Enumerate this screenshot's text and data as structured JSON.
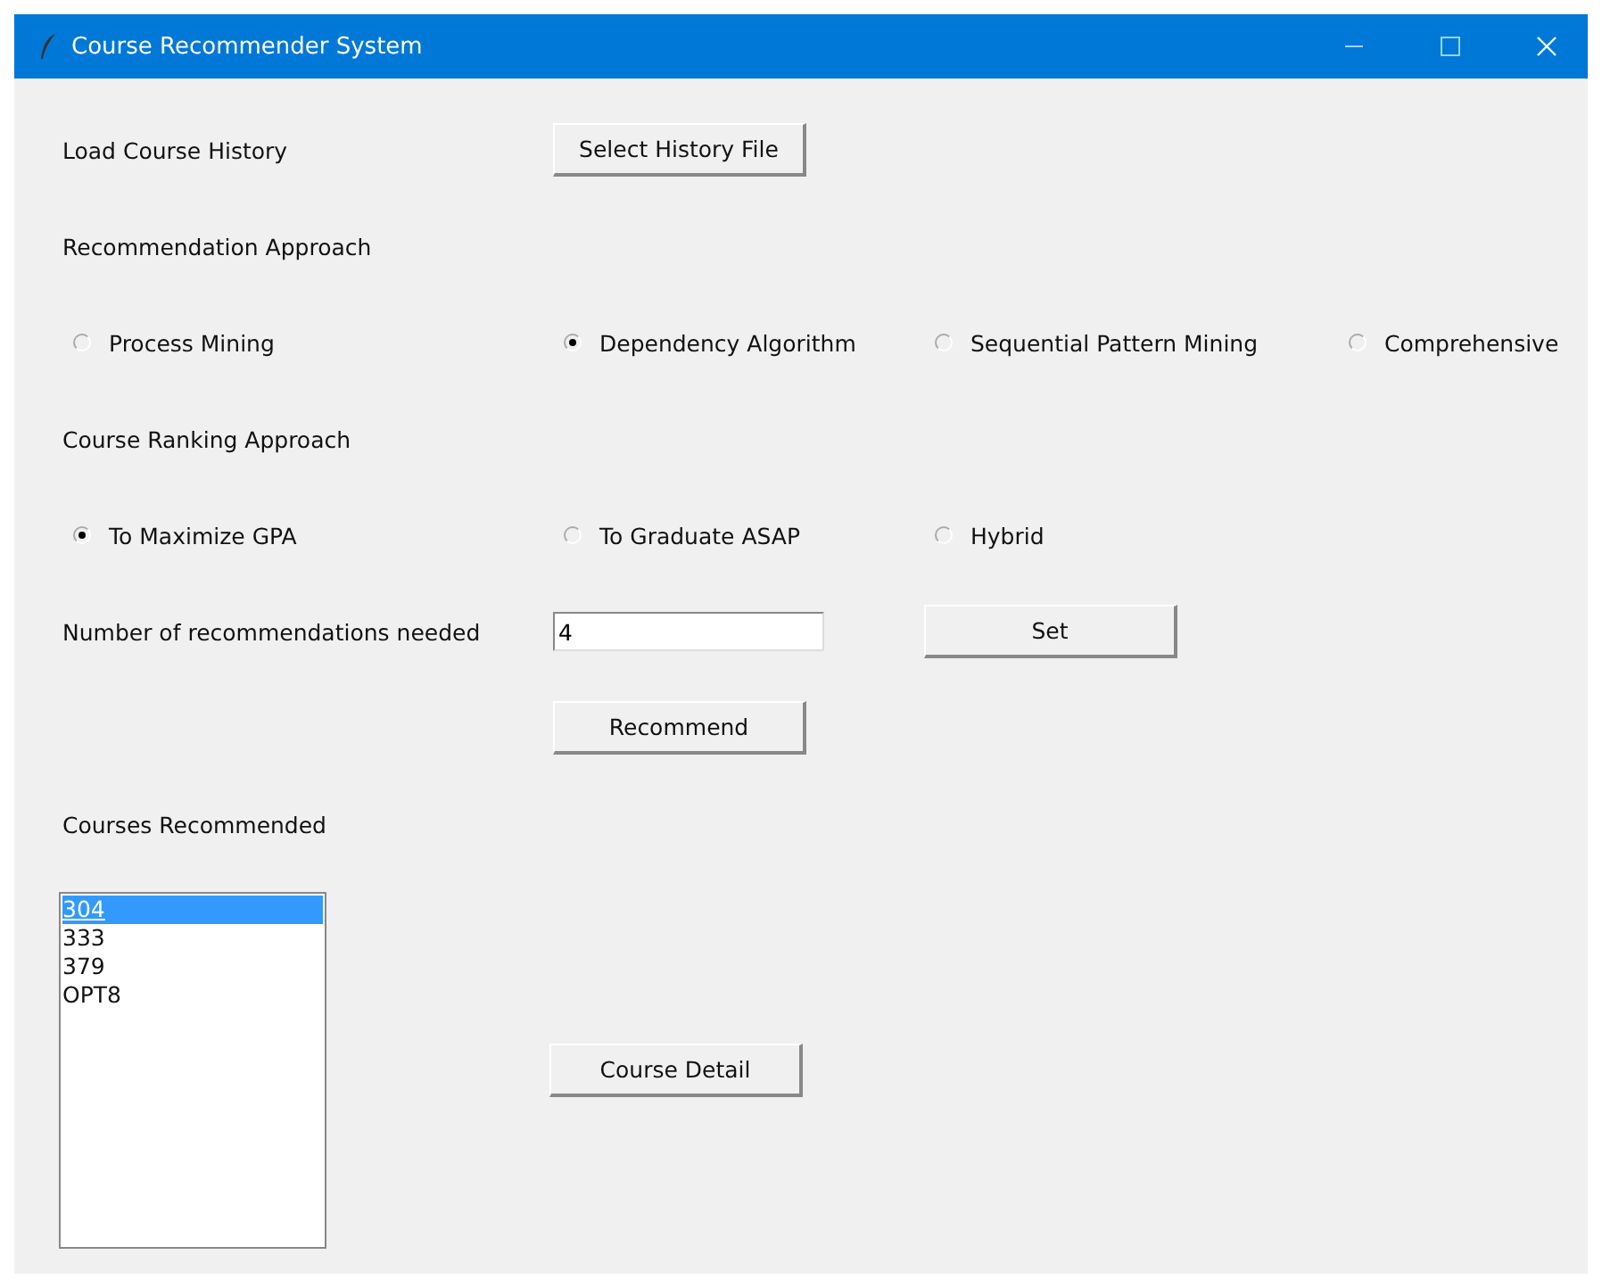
{
  "window": {
    "title": "Course Recommender System"
  },
  "history": {
    "label": "Load Course History",
    "button": "Select History File"
  },
  "recommendation_approach": {
    "label": "Recommendation Approach",
    "options": [
      {
        "label": "Process Mining",
        "selected": false
      },
      {
        "label": "Dependency Algorithm",
        "selected": true
      },
      {
        "label": "Sequential Pattern Mining",
        "selected": false
      },
      {
        "label": "Comprehensive",
        "selected": false
      }
    ]
  },
  "ranking_approach": {
    "label": "Course Ranking Approach",
    "options": [
      {
        "label": "To Maximize GPA",
        "selected": true
      },
      {
        "label": "To Graduate ASAP",
        "selected": false
      },
      {
        "label": "Hybrid",
        "selected": false
      }
    ]
  },
  "count": {
    "label": "Number of recommendations needed",
    "value": "4",
    "set_button": "Set"
  },
  "recommend_button": "Recommend",
  "courses": {
    "label": "Courses Recommended",
    "items": [
      {
        "label": "304",
        "selected": true
      },
      {
        "label": "333",
        "selected": false
      },
      {
        "label": "379",
        "selected": false
      },
      {
        "label": "OPT8",
        "selected": false
      }
    ]
  },
  "detail_button": "Course Detail"
}
